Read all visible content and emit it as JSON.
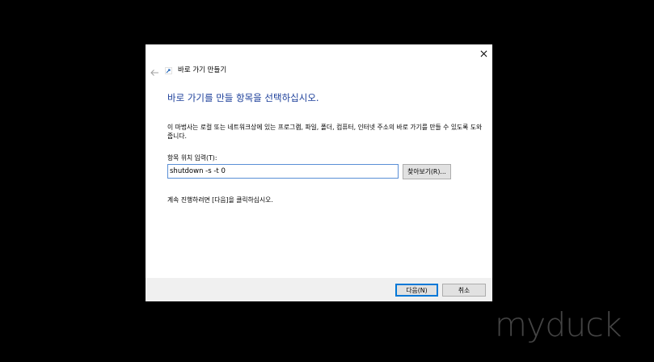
{
  "dialog": {
    "title": "바로 가기 만들기",
    "main_instruction": "바로 가기를 만들 항목을 선택하십시오.",
    "description": "이 마법사는 로컬 또는 네트워크상에 있는 프로그램, 파일, 폴더, 컴퓨터, 인터넷 주소의 바로 가기를 만들 수 있도록 도와줍니다.",
    "location_label": "항목 위치 입력(T):",
    "location_value": "shutdown -s -t 0",
    "browse_label": "찾아보기(R)...",
    "continue_text": "계속 진행하려면 [다음]을 클릭하십시오.",
    "next_label": "다음(N)",
    "cancel_label": "취소",
    "icons": {
      "close": "close-icon",
      "back": "back-arrow-icon",
      "wizard": "shortcut-icon"
    }
  },
  "watermark": "myduck",
  "colors": {
    "background": "#000000",
    "heading": "#1a3d99",
    "input_border": "#5a8fd6",
    "default_button_border": "#0078d7",
    "footer": "#f0f0f0"
  }
}
